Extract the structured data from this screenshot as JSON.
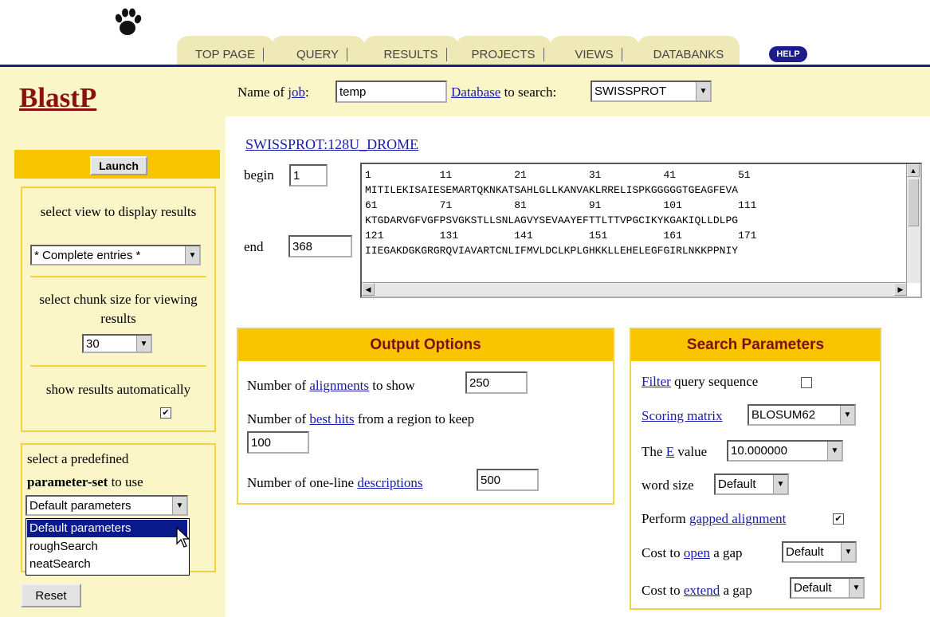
{
  "nav": {
    "tabs": [
      "TOP PAGE",
      "QUERY",
      "RESULTS",
      "PROJECTS",
      "VIEWS",
      "DATABANKS"
    ],
    "help": "HELP"
  },
  "app": {
    "title": "BlastP"
  },
  "sidebar": {
    "launch": "Launch",
    "view_label": "select view to display results",
    "view_value": "* Complete entries *",
    "chunk_label": "select chunk size for viewing results",
    "chunk_value": "30",
    "show_results_label": "show results automatically",
    "show_results_checked": true,
    "param_pre": "select a predefined",
    "param_bold": "parameter-set",
    "param_post": "to use",
    "param_value": "Default parameters",
    "param_options": [
      "Default parameters",
      "roughSearch",
      "neatSearch"
    ],
    "reset": "Reset"
  },
  "job": {
    "name_pre": "Name of",
    "name_link": "job",
    "name_post": ":",
    "name_value": "temp",
    "db_link": "Database",
    "db_post": "to search:",
    "db_value": "SWISSPROT"
  },
  "sequence": {
    "id": "SWISSPROT:128U_DROME",
    "begin_label": "begin",
    "begin_value": "1",
    "end_label": "end",
    "end_value": "368",
    "text": "1           11          21          31          41          51\nMITILEKISAIESEMARTQKNKATSAHLGLLKANVAKLRRELISPKGGGGGTGEAGFEVA\n61          71          81          91          101         111\nKTGDARVGFVGFPSVGKSTLLSNLAGVYSEVAAYEFTTLTTVPGCIKYKGAKIQLLDLPG\n121         131         141         151         161         171\nIIEGAKDGKGRGRQVIAVARTCNLIFMVLDCLKPLGHKKLLEHELEGFGIRLNKKPPNIY"
  },
  "output": {
    "title": "Output Options",
    "align_pre": "Number of",
    "align_link": "alignments",
    "align_post": "to show",
    "align_value": "250",
    "hits_pre": "Number of",
    "hits_link": "best hits",
    "hits_post": "from a region to keep",
    "hits_value": "100",
    "desc_pre": "Number of one-line",
    "desc_link": "descriptions",
    "desc_value": "500"
  },
  "search": {
    "title": "Search Parameters",
    "filter_link": "Filter",
    "filter_post": "query sequence",
    "filter_checked": false,
    "matrix_link": "Scoring matrix",
    "matrix_value": "BLOSUM62",
    "e_pre": "The",
    "e_link": "E",
    "e_post": "value",
    "e_value": "10.000000",
    "word_label": "word size",
    "word_value": "Default",
    "gapped_pre": "Perform",
    "gapped_link": "gapped alignment",
    "gapped_checked": true,
    "open_pre": "Cost to",
    "open_link": "open",
    "open_post": "a gap",
    "open_value": "Default",
    "extend_pre": "Cost to",
    "extend_link": "extend",
    "extend_post": "a gap",
    "extend_value": "Default"
  }
}
